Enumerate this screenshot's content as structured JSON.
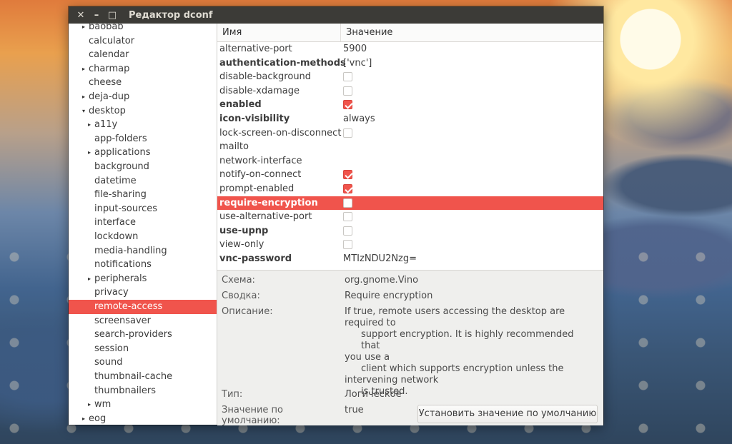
{
  "window": {
    "title": "Редактор dconf"
  },
  "titlebar": {
    "close": "✕",
    "minimize": "–",
    "maximize": "□"
  },
  "sidebar": {
    "items": [
      {
        "label": "baobab",
        "indent": 0,
        "arrow": "▸"
      },
      {
        "label": "calculator",
        "indent": 0,
        "arrow": ""
      },
      {
        "label": "calendar",
        "indent": 0,
        "arrow": ""
      },
      {
        "label": "charmap",
        "indent": 0,
        "arrow": "▸"
      },
      {
        "label": "cheese",
        "indent": 0,
        "arrow": ""
      },
      {
        "label": "deja-dup",
        "indent": 0,
        "arrow": "▸"
      },
      {
        "label": "desktop",
        "indent": 0,
        "arrow": "▾"
      },
      {
        "label": "a11y",
        "indent": 1,
        "arrow": "▸"
      },
      {
        "label": "app-folders",
        "indent": 1,
        "arrow": ""
      },
      {
        "label": "applications",
        "indent": 1,
        "arrow": "▸"
      },
      {
        "label": "background",
        "indent": 1,
        "arrow": ""
      },
      {
        "label": "datetime",
        "indent": 1,
        "arrow": ""
      },
      {
        "label": "file-sharing",
        "indent": 1,
        "arrow": ""
      },
      {
        "label": "input-sources",
        "indent": 1,
        "arrow": ""
      },
      {
        "label": "interface",
        "indent": 1,
        "arrow": ""
      },
      {
        "label": "lockdown",
        "indent": 1,
        "arrow": ""
      },
      {
        "label": "media-handling",
        "indent": 1,
        "arrow": ""
      },
      {
        "label": "notifications",
        "indent": 1,
        "arrow": ""
      },
      {
        "label": "peripherals",
        "indent": 1,
        "arrow": "▸"
      },
      {
        "label": "privacy",
        "indent": 1,
        "arrow": ""
      },
      {
        "label": "remote-access",
        "indent": 1,
        "arrow": "",
        "selected": true
      },
      {
        "label": "screensaver",
        "indent": 1,
        "arrow": ""
      },
      {
        "label": "search-providers",
        "indent": 1,
        "arrow": ""
      },
      {
        "label": "session",
        "indent": 1,
        "arrow": ""
      },
      {
        "label": "sound",
        "indent": 1,
        "arrow": ""
      },
      {
        "label": "thumbnail-cache",
        "indent": 1,
        "arrow": ""
      },
      {
        "label": "thumbnailers",
        "indent": 1,
        "arrow": ""
      },
      {
        "label": "wm",
        "indent": 1,
        "arrow": "▸"
      },
      {
        "label": "eog",
        "indent": 0,
        "arrow": "▸"
      }
    ]
  },
  "table": {
    "col_name": "Имя",
    "col_value": "Значение",
    "rows": [
      {
        "key": "alternative-port",
        "bold": false,
        "type": "text",
        "value": "5900"
      },
      {
        "key": "authentication-methods",
        "bold": true,
        "type": "text",
        "value": "['vnc']"
      },
      {
        "key": "disable-background",
        "bold": false,
        "type": "check",
        "checked": false
      },
      {
        "key": "disable-xdamage",
        "bold": false,
        "type": "check",
        "checked": false
      },
      {
        "key": "enabled",
        "bold": true,
        "type": "check",
        "checked": true
      },
      {
        "key": "icon-visibility",
        "bold": true,
        "type": "text",
        "value": "always"
      },
      {
        "key": "lock-screen-on-disconnect",
        "bold": false,
        "type": "check",
        "checked": false
      },
      {
        "key": "mailto",
        "bold": false,
        "type": "text",
        "value": ""
      },
      {
        "key": "network-interface",
        "bold": false,
        "type": "text",
        "value": ""
      },
      {
        "key": "notify-on-connect",
        "bold": false,
        "type": "check",
        "checked": true
      },
      {
        "key": "prompt-enabled",
        "bold": false,
        "type": "check",
        "checked": true
      },
      {
        "key": "require-encryption",
        "bold": true,
        "type": "check",
        "checked": false,
        "selected": true
      },
      {
        "key": "use-alternative-port",
        "bold": false,
        "type": "check",
        "checked": false
      },
      {
        "key": "use-upnp",
        "bold": true,
        "type": "check",
        "checked": false
      },
      {
        "key": "view-only",
        "bold": false,
        "type": "check",
        "checked": false
      },
      {
        "key": "vnc-password",
        "bold": true,
        "type": "text",
        "value": "MTIzNDU2Nzg="
      }
    ]
  },
  "details": {
    "schema_label": "Схема:",
    "schema_value": "org.gnome.Vino",
    "summary_label": "Сводка:",
    "summary_value": "Require encryption",
    "description_label": "Описание:",
    "description_lines": [
      {
        "text": "If true, remote users accessing the desktop are",
        "indent": false
      },
      {
        "text": "required to",
        "indent": false
      },
      {
        "text": "support encryption. It is highly recommended that",
        "indent": true
      },
      {
        "text": "you use a",
        "indent": false
      },
      {
        "text": "client which supports encryption unless the",
        "indent": true
      },
      {
        "text": "intervening network",
        "indent": false
      },
      {
        "text": "is trusted.",
        "indent": true
      }
    ],
    "type_label": "Тип:",
    "type_value": "Логическое",
    "default_label": "Значение по умолчанию:",
    "default_value": "true",
    "set_default_button": "Установить значение по умолчанию"
  },
  "colors": {
    "accent": "#f0544c",
    "titlebar": "#3c3b37"
  }
}
